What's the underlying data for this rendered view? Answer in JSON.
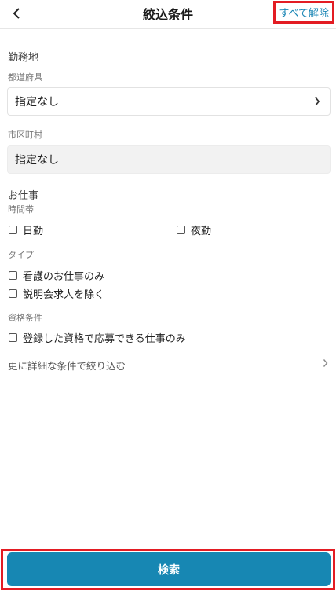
{
  "header": {
    "title": "絞込条件",
    "clear_all": "すべて解除"
  },
  "location": {
    "section_title": "勤務地",
    "prefecture_label": "都道府県",
    "prefecture_value": "指定なし",
    "city_label": "市区町村",
    "city_value": "指定なし"
  },
  "job": {
    "section_title": "お仕事",
    "time_label": "時間帯",
    "time_options": [
      "日勤",
      "夜勤"
    ],
    "type_label": "タイプ",
    "type_options": [
      "看護のお仕事のみ",
      "説明会求人を除く"
    ],
    "qualification_label": "資格条件",
    "qualification_options": [
      "登録した資格で応募できる仕事のみ"
    ]
  },
  "more_filters": "更に詳細な条件で絞り込む",
  "search_button": "検索",
  "colors": {
    "accent": "#1787b3",
    "link": "#1a86b5",
    "highlight": "#e31c23"
  }
}
